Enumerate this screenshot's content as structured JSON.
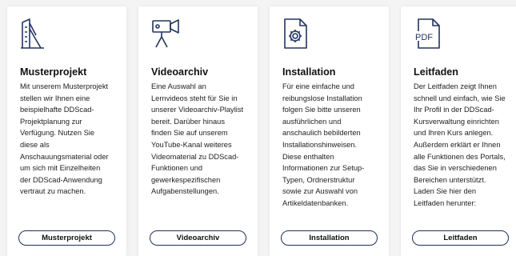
{
  "colors": {
    "icon_stroke": "#22345f",
    "button_border": "#1f2f57",
    "card_bg": "#ffffff",
    "page_bg": "#f4f4f4"
  },
  "cards": [
    {
      "icon": "building-icon",
      "title": "Musterprojekt",
      "text": "Mit unserem Musterprojekt\nstellen wir Ihnen eine\nbeispielhafte DDScad-\nProjektplanung zur\nVerfügung. Nutzen Sie\ndiese als\nAnschauungsmaterial oder\num sich mit Einzelheiten\nder DDScad-Anwendung\nvertraut zu machen.",
      "button_label": "Musterprojekt"
    },
    {
      "icon": "video-camera-icon",
      "title": "Videoarchiv",
      "text": "Eine Auswahl an\nLernvideos steht für Sie in\nunserer Videoarchiv-Playlist\nbereit. Darüber hinaus\nfinden Sie auf unserem\nYouTube-Kanal weiteres\nVideomaterial zu DDScad-\nFunktionen und\ngewerkespezifischen\nAufgabenstellungen.",
      "button_label": "Videoarchiv"
    },
    {
      "icon": "settings-document-icon",
      "title": "Installation",
      "text": "Für eine einfache und\nreibungslose Installation\nfolgen Sie bitte unseren\nausführlichen und\nanschaulich bebilderten\nInstallationshinweisen.\nDiese enthalten\nInformationen zur Setup-\nTypen, Ordnerstruktur\nsowie zur Auswahl von\nArtikeldatenbanken.",
      "button_label": "Installation"
    },
    {
      "icon": "pdf-document-icon",
      "title": "Leitfaden",
      "text": "Der Leitfaden zeigt Ihnen\nschnell und einfach, wie Sie\nIhr Profil in der DDScad-\nKursverwaltung einrichten\nund Ihren Kurs anlegen.\nAußerdem erklärt er Ihnen\nalle Funktionen des Portals,\ndas Sie in verschiedenen\nBereichen unterstützt.\nLaden Sie hier den\nLeitfaden herunter:",
      "button_label": "Leitfaden"
    }
  ]
}
